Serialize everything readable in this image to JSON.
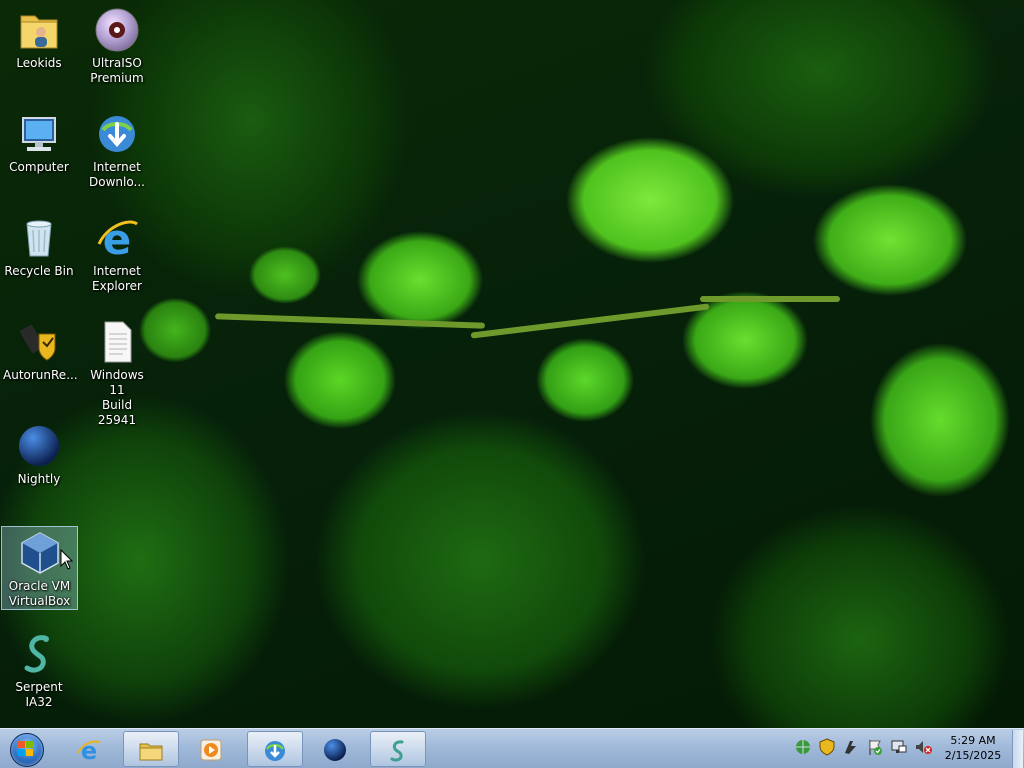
{
  "desktop": {
    "icons": [
      {
        "id": "leokids",
        "label": "Leokids",
        "icon": "user-folder-icon"
      },
      {
        "id": "ultraiso",
        "label": "UltraISO\nPremium",
        "label1": "UltraISO",
        "label2": "Premium",
        "icon": "disc-icon"
      },
      {
        "id": "computer",
        "label": "Computer",
        "icon": "computer-icon"
      },
      {
        "id": "idm",
        "label1": "Internet",
        "label2": "Downlo...",
        "icon": "download-manager-icon"
      },
      {
        "id": "recycle",
        "label": "Recycle Bin",
        "icon": "recycle-bin-icon"
      },
      {
        "id": "ie",
        "label1": "Internet",
        "label2": "Explorer",
        "icon": "internet-explorer-icon"
      },
      {
        "id": "autorun",
        "label": "AutorunRe...",
        "icon": "usb-shield-icon"
      },
      {
        "id": "win11",
        "label1": "Windows 11",
        "label2": "Build 25941",
        "icon": "text-file-icon"
      },
      {
        "id": "nightly",
        "label": "Nightly",
        "icon": "firefox-nightly-icon"
      },
      {
        "id": "virtualbox",
        "label1": "Oracle VM",
        "label2": "VirtualBox",
        "icon": "virtualbox-icon",
        "selected": true
      },
      {
        "id": "serpent",
        "label": "Serpent IA32",
        "icon": "serpent-icon"
      }
    ]
  },
  "taskbar": {
    "pinned": [
      {
        "name": "internet-explorer",
        "icon": "internet-explorer-icon"
      },
      {
        "name": "windows-explorer",
        "icon": "folder-icon"
      },
      {
        "name": "media-player",
        "icon": "media-player-icon"
      },
      {
        "name": "download-manager",
        "icon": "download-manager-icon"
      },
      {
        "name": "nightly",
        "icon": "firefox-nightly-icon"
      },
      {
        "name": "serpent",
        "icon": "serpent-icon"
      }
    ],
    "tray": [
      {
        "name": "network",
        "icon": "network-globe-icon"
      },
      {
        "name": "security",
        "icon": "shield-icon"
      },
      {
        "name": "app",
        "icon": "tray-app-icon"
      },
      {
        "name": "action-center",
        "icon": "action-center-flag-icon"
      },
      {
        "name": "network-status",
        "icon": "network-monitor-icon"
      },
      {
        "name": "volume",
        "icon": "volume-muted-icon"
      }
    ],
    "clock": {
      "time": "5:29 AM",
      "date": "2/15/2025"
    }
  },
  "colors": {
    "taskbar_top": "#b9cde6",
    "taskbar_bottom": "#8ea9cc",
    "leaf_bright": "#6adf2f",
    "leaf_dark": "#114a0a"
  }
}
